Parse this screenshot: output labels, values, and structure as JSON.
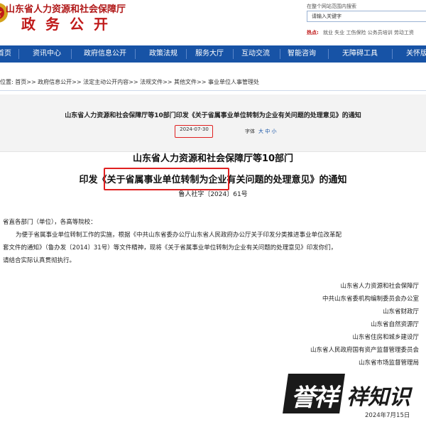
{
  "header": {
    "org_name": "山东省人力资源和社会保障厅",
    "site_title": "政务公开",
    "search_caption": "在整个网站范围内搜索",
    "search_placeholder": "请输入关键字",
    "hot_label": "热点:",
    "hot_text": "就业 失业 工伤保险 公务员培训 劳动工资"
  },
  "nav": {
    "items": [
      "首页",
      "资讯中心",
      "政府信息公开",
      "政策法规",
      "服务大厅",
      "互动交流",
      "智能咨询",
      "无障碍工具",
      "关怀版"
    ]
  },
  "breadcrumb": "位置: 首页>> 政府信息公开>> 法定主动公开内容>> 法规文件>> 其他文件>> 事业单位人事管理处",
  "article": {
    "title": "山东省人力资源和社会保障厅等10部门印发《关于省属事业单位转制为企业有关问题的处理意见》的通知",
    "date": "2024-07-30",
    "font_label": "字体",
    "font_sizes": "大 中 小"
  },
  "document": {
    "title_line_1": "山东省人力资源和社会保障厅等10部门",
    "title_line_2": "印发《关于省属事业单位转制为企业有关问题的处理意见》的通知",
    "doc_number": "鲁人社字〔2024〕61号",
    "recipients": "省直各部门（单位），各高等院校：",
    "para_1": "为便于省属事业单位转制工作的实施，根据《中共山东省委办公厅山东省人民政府办公厅关于印发分类推进事业单位改革配",
    "para_2": "套文件的通知》（鲁办发〔2014〕31号）等文件精神，现将《关于省属事业单位转制为企业有关问题的处理意见》印发你们，",
    "para_3": "请结合实际认真贯彻执行。",
    "signatories": [
      "山东省人力资源和社会保障厅",
      "中共山东省委机构编制委员会办公室",
      "山东省财政厅",
      "山东省自然资源厅",
      "山东省住房和城乡建设厅",
      "山东省人民政府国有资产监督管理委员会",
      "山东省市场监督管理局"
    ],
    "sign_date": "2024年7月15日"
  },
  "watermark": {
    "text_1": "誉祥",
    "text_2": "祥知识"
  },
  "colors": {
    "brand_red": "#c01a1a",
    "nav_blue": "#1753a6",
    "highlight_red": "#e02020"
  }
}
